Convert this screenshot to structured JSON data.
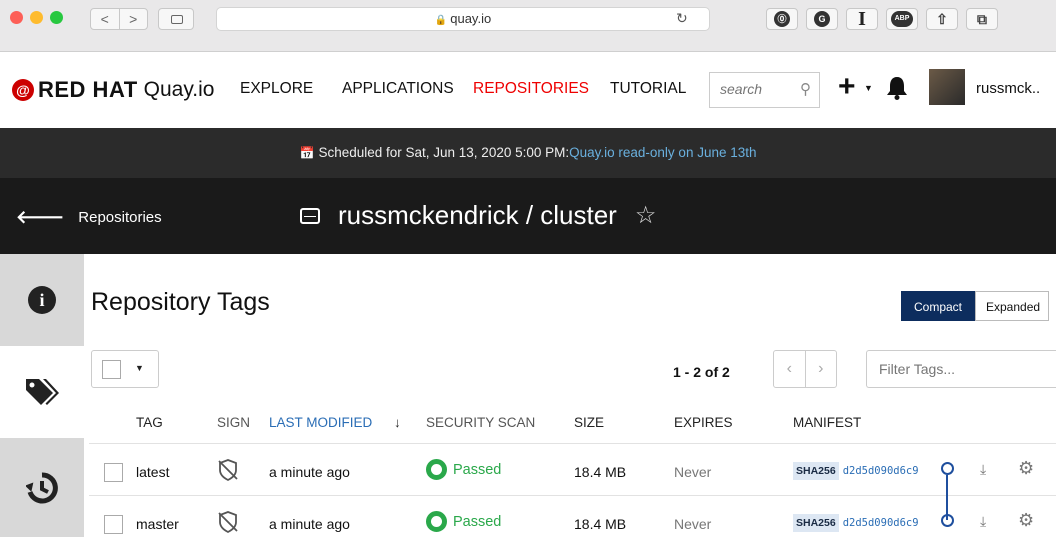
{
  "browser": {
    "url": "quay.io",
    "nav_back": "<",
    "nav_forward": ">",
    "extensions": [
      "⓪",
      "G",
      "I",
      "ABP",
      "⇧",
      "⧉"
    ]
  },
  "header": {
    "brand_redhat": "RED HAT",
    "brand_quay": "Quay.io",
    "nav": [
      "EXPLORE",
      "APPLICATIONS",
      "REPOSITORIES",
      "TUTORIAL"
    ],
    "search_placeholder": "search",
    "username": "russmck.."
  },
  "announcement": {
    "text": "Scheduled for Sat, Jun 13, 2020 5:00 PM:",
    "link": "Quay.io read-only on June 13th"
  },
  "banner": {
    "back_label": "Repositories",
    "repo_name": "russmckendrick / cluster"
  },
  "sidebar": {
    "icons": [
      "info-icon",
      "tags-icon",
      "history-icon"
    ]
  },
  "tags": {
    "title": "Repository Tags",
    "view_compact": "Compact",
    "view_expanded": "Expanded",
    "pagination": "1 - 2 of 2",
    "filter_placeholder": "Filter Tags...",
    "columns": {
      "tag": "TAG",
      "sign": "SIGN",
      "last_modified": "LAST MODIFIED",
      "sort_indicator": "↓",
      "security_scan": "SECURITY SCAN",
      "size": "SIZE",
      "expires": "EXPIRES",
      "manifest": "MANIFEST"
    },
    "rows": [
      {
        "tag": "latest",
        "modified": "a minute ago",
        "scan": "Passed",
        "size": "18.4 MB",
        "expires": "Never",
        "sha_label": "SHA256",
        "digest": "d2d5d090d6c9"
      },
      {
        "tag": "master",
        "modified": "a minute ago",
        "scan": "Passed",
        "size": "18.4 MB",
        "expires": "Never",
        "sha_label": "SHA256",
        "digest": "d2d5d090d6c9"
      }
    ]
  },
  "colors": {
    "accent_red": "#e00000",
    "passed_green": "#2aa84a",
    "compact_active": "#0d2d5e",
    "link_blue": "#2a6db5"
  }
}
